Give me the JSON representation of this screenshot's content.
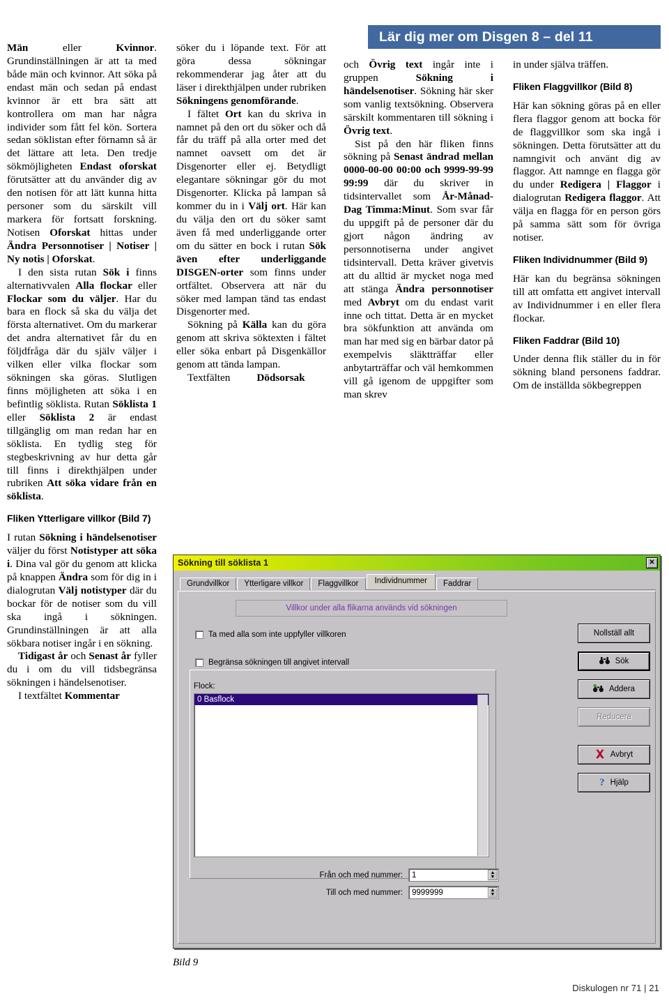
{
  "header": {
    "title": "Lär dig mer om Disgen 8 – del 11",
    "accent_color": "#41699f"
  },
  "columns": {
    "col1": {
      "p1_a": "Män",
      "p1_b": " eller ",
      "p1_c": "Kvinnor",
      "p1_d": ". Grundinställningen är att ta med både män och kvinnor. Att söka på endast män och sedan på endast kvinnor är ett bra sätt att kontrollera om man har några individer som fått fel kön. Sortera sedan söklistan efter förnamn så är det lättare att leta. Den tredje sökmöjligheten ",
      "p1_e": "Endast oforskat",
      "p1_f": " förutsätter att du använder dig av den notisen för att lätt kunna hitta personer som du särskilt vill markera för fortsatt forskning. Notisen ",
      "p1_g": "Oforskat",
      "p1_h": " hittas under ",
      "p1_i": "Ändra Personnotiser | Notiser | Ny notis | Oforskat",
      "p1_j": ".",
      "p2_a": "I den sista rutan ",
      "p2_b": "Sök i",
      "p2_c": " finns alternativvalen ",
      "p2_d": "Alla flockar",
      "p2_e": " eller ",
      "p2_f": "Flockar som du väljer",
      "p2_g": ". Har du bara en flock så ska du välja det första alternativet. Om du markerar det andra alternativet får du en följdfråga där du själv väljer i vilken eller vilka flockar som sökningen ska göras. Slutligen finns möjligheten att söka i en befintlig söklista. Rutan ",
      "p2_h": "Söklista 1",
      "p2_i": " eller ",
      "p2_j": "Söklista 2",
      "p2_k": " är endast tillgänglig om man redan har en söklista. En tydlig steg för stegbeskrivning av hur detta går till finns i direkthjälpen under rubriken ",
      "p2_l": "Att söka vidare från en söklista",
      "p2_m": ".",
      "subhead1": "Fliken Ytterligare villkor (Bild 7)",
      "p3_a": "I rutan ",
      "p3_b": "Sökning i händelsenotiser",
      "p3_c": " väljer du först ",
      "p3_d": "Notistyper att söka i",
      "p3_e": ". Dina val gör du genom att klicka på knappen ",
      "p3_f": "Ändra",
      "p3_g": " som för dig in i dialogrutan ",
      "p3_h": "Välj notistyper",
      "p3_i": " där du bockar för de notiser som du vill ska ingå i sökningen. Grundinställningen är att alla sökbara notiser ingår i en sökning.",
      "p4_a": "Tidigast år",
      "p4_b": " och ",
      "p4_c": "Senast år",
      "p4_d": " fyller du i om du vill tidsbegränsa sökningen i händelsenotiser.",
      "p5_a": "I textfältet ",
      "p5_b": "Kommentar"
    },
    "col2": {
      "p1_a": "söker du i löpande text. För att göra dessa sökningar rekommenderar jag åter att du läser i direkthjälpen under rubriken ",
      "p1_b": "Sökningens genomförande",
      "p1_c": ".",
      "p2_a": "I fältet ",
      "p2_b": "Ort",
      "p2_c": " kan du skriva in namnet på den ort du söker och då får du träff på alla orter med det namnet oavsett om det är Disgenorter eller ej. Betydligt elegantare sökningar gör du mot Disgenorter. Klicka på lampan så kommer du in i ",
      "p2_d": "Välj ort",
      "p2_e": ". Här kan du välja den ort du söker samt även få med underliggande orter om du sätter en bock i rutan ",
      "p2_f": "Sök även efter underliggande DISGEN-orter",
      "p2_g": " som finns under ortfältet. Observera att när du söker med lampan tänd tas endast Disgenorter med.",
      "p3_a": "Sökning på ",
      "p3_b": "Källa",
      "p3_c": " kan du göra genom att skriva söktexten i fältet eller söka enbart på Disgenkällor genom att tända lampan.",
      "p4_a": "Textfälten",
      "p4_b": "Dödsorsak"
    },
    "col3": {
      "p1_a": "och ",
      "p1_b": "Övrig text",
      "p1_c": " ingår inte i gruppen ",
      "p1_d": "Sökning i händelsenotiser",
      "p1_e": ". Sökning här sker som vanlig textsökning. Observera särskilt kommentaren till sökning i ",
      "p1_f": "Övrig text",
      "p1_g": ".",
      "p2_a": "Sist på den här fliken finns sökning på ",
      "p2_b": "Senast ändrad mellan 0000-00-00 00:00 och 9999-99-99 99:99",
      "p2_c": " där du skriver in tidsintervallet som ",
      "p2_d": "År-Månad-Dag Timma:Minut",
      "p2_e": ". Som svar får du uppgift på de personer där du gjort någon ändring av personnotiserna under angivet tidsintervall. Detta kräver givetvis att du alltid är mycket noga med att stänga ",
      "p2_f": "Ändra personnotiser",
      "p2_g": " med ",
      "p2_h": "Avbryt",
      "p2_i": " om du endast varit inne och tittat. Detta är en mycket bra sökfunktion att använda om man har med sig en bärbar dator på exempelvis släktträffar eller anbytarträffar och väl hemkommen vill gå igenom de uppgifter som man skrev"
    },
    "col4": {
      "p1": "in under själva träffen.",
      "subhead1": "Fliken Flaggvillkor (Bild 8)",
      "p2_a": "Här kan sökning göras på en eller flera flaggor genom att bocka för de flaggvillkor som ska ingå i sökningen. Detta förutsätter att du namngivit och använt dig av flaggor. Att namnge en flagga gör du under ",
      "p2_b": "Redigera | Flaggor",
      "p2_c": " i dialogrutan ",
      "p2_d": "Redigera flaggor",
      "p2_e": ". Att välja en flagga för en person görs på samma sätt som för övriga notiser.",
      "subhead2": "Fliken Individnummer (Bild 9)",
      "p3": "Här kan du begränsa sökningen till att omfatta ett angivet intervall av Individnummer i en eller flera flockar.",
      "subhead3": "Fliken Faddrar (Bild 10)",
      "p4": "Under denna flik ställer du in för sökning bland personens faddrar. Om de inställda sökbegreppen"
    }
  },
  "dialog": {
    "title": "Sökning till söklista 1",
    "close_label": "✕",
    "tabs": [
      {
        "label": "Grundvillkor",
        "active": false
      },
      {
        "label": "Ytterligare villkor",
        "active": false
      },
      {
        "label": "Flaggvillkor",
        "active": false
      },
      {
        "label": "Individnummer",
        "active": true
      },
      {
        "label": "Faddrar",
        "active": false
      }
    ],
    "notice": "Villkor under alla flikarna används vid sökningen",
    "check_all": "Ta med alla som inte uppfyller villkoren",
    "check_interval": "Begränsa sökningen till angivet intervall",
    "flock_label": "Flock:",
    "flock_selected": "0 Basflock",
    "from_label": "Från och med nummer:",
    "from_value": "1",
    "to_label": "Till och med nummer:",
    "to_value": "9999999",
    "buttons": [
      {
        "name": "nollstall",
        "label": "Nollställ allt",
        "icon": "",
        "disabled": false
      },
      {
        "name": "sok",
        "label": "Sök",
        "icon": "binoculars-icon",
        "glyph": "🕶",
        "disabled": false
      },
      {
        "name": "addera",
        "label": "Addera",
        "icon": "binoculars-plus-icon",
        "glyph": "🕶",
        "disabled": false
      },
      {
        "name": "reducera",
        "label": "Reducera",
        "icon": "",
        "disabled": true
      },
      {
        "name": "avbryt",
        "label": "Avbryt",
        "icon": "red-x-icon",
        "glyph": "✖",
        "disabled": false
      },
      {
        "name": "hjalp",
        "label": "Hjälp",
        "icon": "question-mark-icon",
        "glyph": "?",
        "disabled": false
      }
    ]
  },
  "caption": "Bild 9",
  "footer": "Diskulogen nr 71 | 21"
}
